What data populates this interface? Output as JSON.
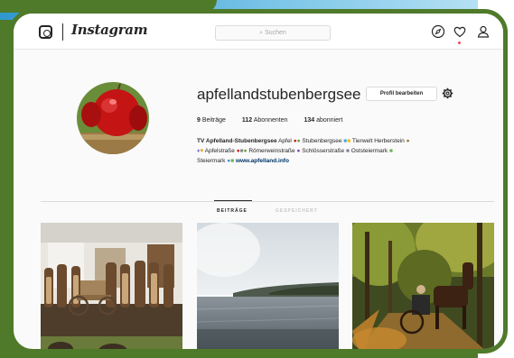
{
  "nav": {
    "wordmark": "Instagram",
    "search_placeholder": "Suchen",
    "icons": [
      "instagram-glyph-icon",
      "search-icon",
      "compass-icon",
      "heart-icon",
      "user-icon"
    ]
  },
  "profile": {
    "username": "apfellandstubenbergsee",
    "edit_button": "Profil bearbeiten",
    "stats": {
      "posts_count": "9",
      "posts_label": "Beiträge",
      "followers_count": "112",
      "followers_label": "Abonnenten",
      "following_count": "134",
      "following_label": "abonniert"
    },
    "bio": {
      "name": "TV Apfelland-Stubenbergsee",
      "seg1": "Apfel",
      "seg2": "Stubenbergsee",
      "seg3": "Tierwelt Herberstein",
      "seg4": "Apfelstraße",
      "seg5": "Römerweinstraße",
      "seg6": "Schlösserstraße",
      "seg7": "Oststeiermark",
      "seg8": "Steiermark",
      "link": "www.apfelland.info"
    }
  },
  "tabs": {
    "posts": "BEITRÄGE",
    "saved": "GESPEICHERT"
  },
  "colors": {
    "frame_green": "#4f7a2a",
    "link_blue": "#003569",
    "notification_red": "#ed4956"
  }
}
